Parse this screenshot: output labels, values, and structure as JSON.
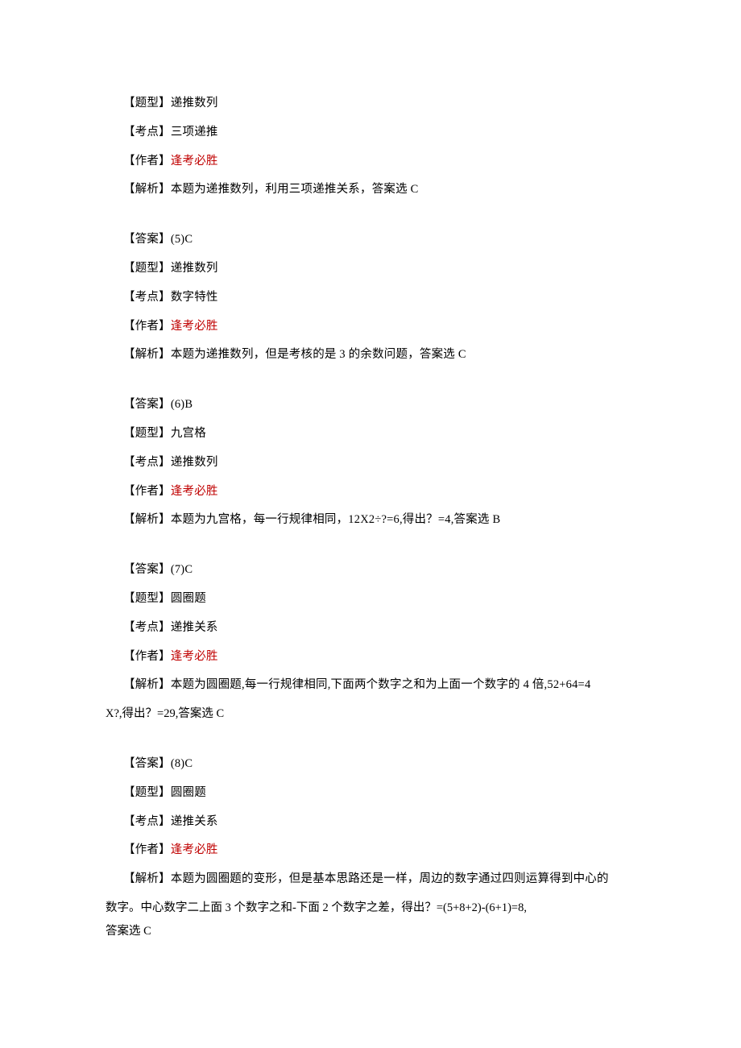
{
  "labels": {
    "type": "【题型】",
    "point": "【考点】",
    "author": "【作者】",
    "analysis": "【解析】",
    "answer": "【答案】"
  },
  "author_name": "逢考必胜",
  "blocks": [
    {
      "type": "递推数列",
      "point": "三项递推",
      "analysis": "本题为递推数列，利用三项递推关系，答案选 C"
    },
    {
      "answer": "(5)C",
      "type": "递推数列",
      "point": "数字特性",
      "analysis": "本题为递推数列，但是考核的是 3 的余数问题，答案选 C"
    },
    {
      "answer": "(6)B",
      "type": "九宫格",
      "point": "递推数列",
      "analysis": "本题为九宫格，每一行规律相同，12X2÷?=6,得出？=4,答案选 B"
    },
    {
      "answer": "(7)C",
      "type": "圆圈题",
      "point": "递推关系",
      "analysis_l1": "本题为圆圈题,每一行规律相同,下面两个数字之和为上面一个数字的 4 倍,52+64=4",
      "analysis_l2": "X?,得出？=29,答案选 C"
    },
    {
      "answer": "(8)C",
      "type": "圆圈题",
      "point": "递推关系",
      "analysis_l1": "本题为圆圈题的变形，但是基本思路还是一样，周边的数字通过四则运算得到中心的",
      "analysis_l2": "数字。中心数字二上面 3 个数字之和-下面 2 个数字之差，得出？=(5+8+2)-(6+1)=8,",
      "analysis_l3": "答案选 C"
    }
  ]
}
